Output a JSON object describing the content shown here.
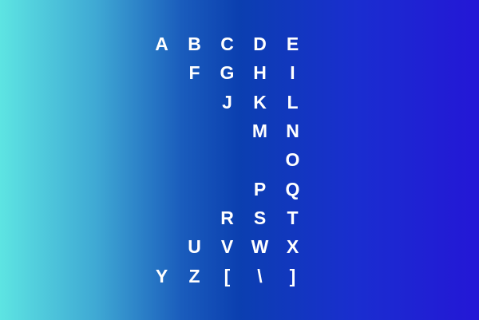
{
  "background": {
    "gradient_colors": [
      "#5de4e2",
      "#3fa9d4",
      "#1a5cbc",
      "#0b3fb0",
      "#1a2dd0",
      "#2417d6"
    ]
  },
  "letter_rows": [
    [
      "A",
      "B",
      "C",
      "D",
      "E"
    ],
    [
      "F",
      "G",
      "H",
      "I"
    ],
    [
      "J",
      "K",
      "L"
    ],
    [
      "M",
      "N"
    ],
    [
      "O"
    ],
    [
      "P",
      "Q"
    ],
    [
      "R",
      "S",
      "T"
    ],
    [
      "U",
      "V",
      "W",
      "X"
    ],
    [
      "Y",
      "Z",
      "[",
      "\\",
      "]"
    ]
  ]
}
